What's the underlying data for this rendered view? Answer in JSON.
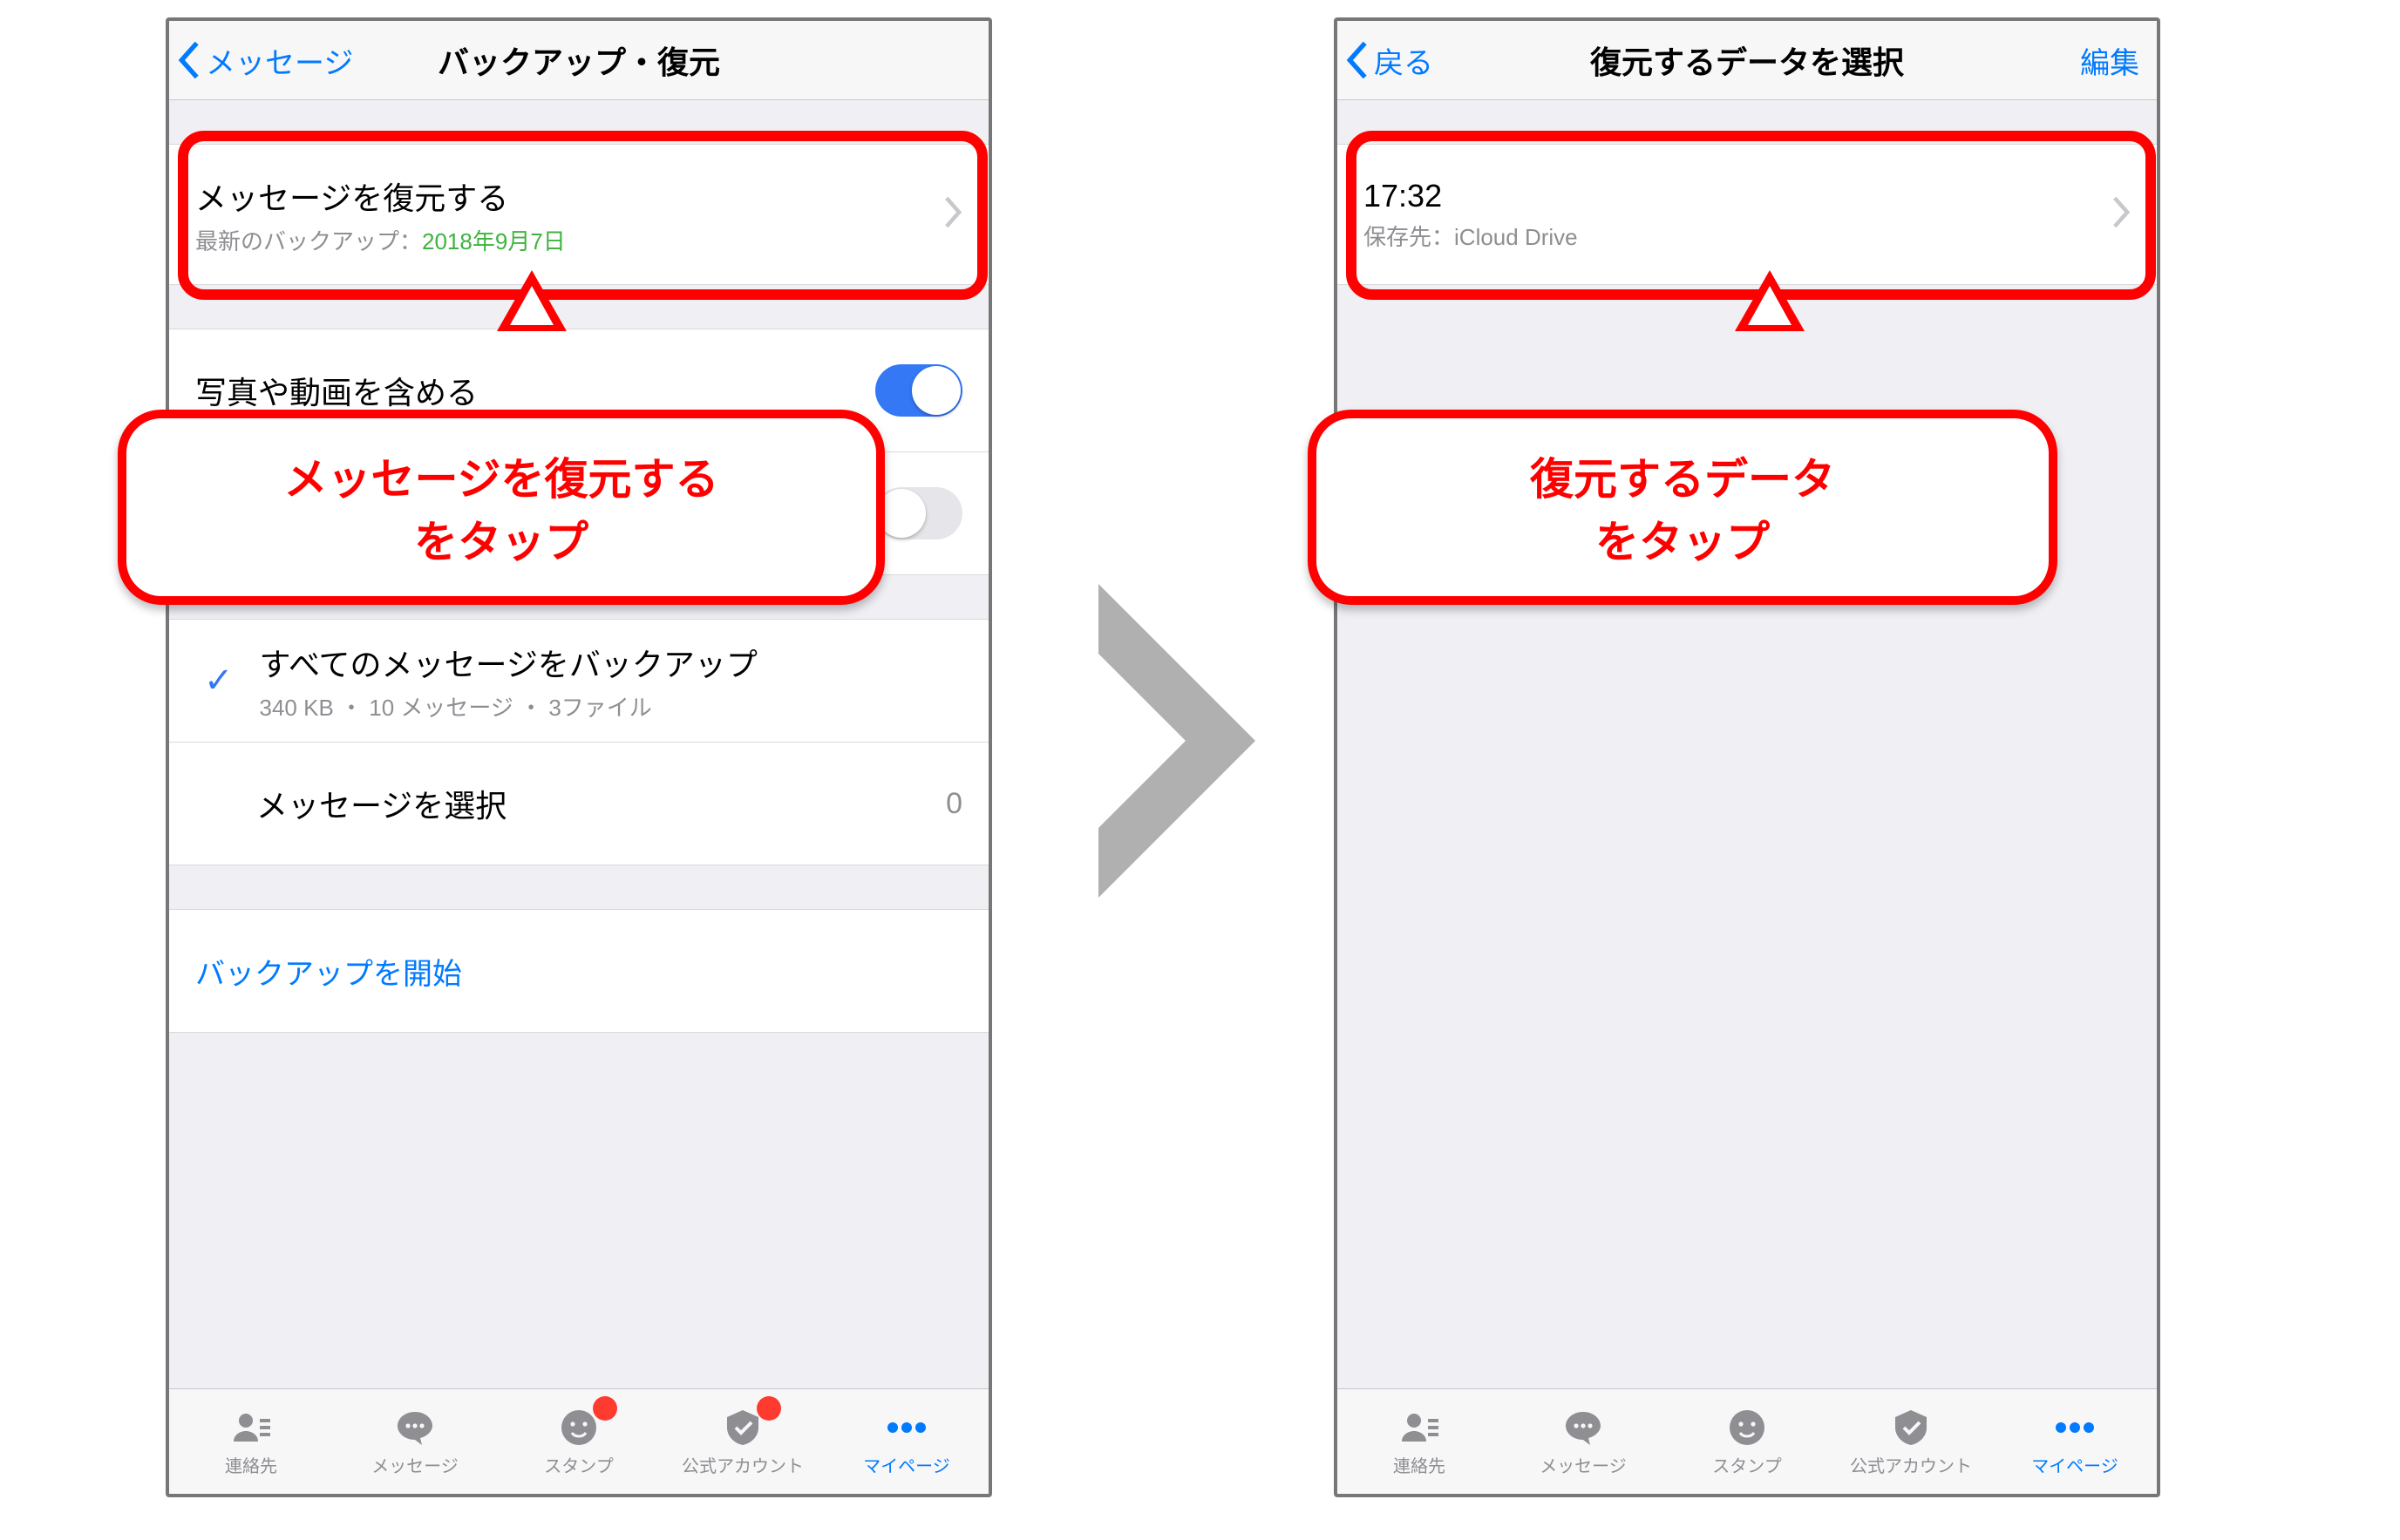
{
  "left": {
    "nav": {
      "back": "メッセージ",
      "title": "バックアップ・復元"
    },
    "restore": {
      "title": "メッセージを復元する",
      "sub_label": "最新のバックアップ：",
      "sub_date": "2018年9月7日"
    },
    "options": {
      "include_media": "写真や動画を含める"
    },
    "backup_all": {
      "title": "すべてのメッセージをバックアップ",
      "detail": "340 KB ・ 10 メッセージ ・ 3ファイル"
    },
    "select_messages": {
      "label": "メッセージを選択",
      "value": "0"
    },
    "start_backup": "バックアップを開始",
    "callout": "メッセージを復元する\nをタップ"
  },
  "right": {
    "nav": {
      "back": "戻る",
      "title": "復元するデータを選択",
      "right": "編集"
    },
    "entry": {
      "time": "17:32",
      "dest_label": "保存先：",
      "dest_value": "iCloud Drive"
    },
    "callout": "復元するデータ\nをタップ"
  },
  "tabs": {
    "contacts": "連絡先",
    "messages": "メッセージ",
    "stamps": "スタンプ",
    "official": "公式アカウント",
    "mypage": "マイページ"
  }
}
